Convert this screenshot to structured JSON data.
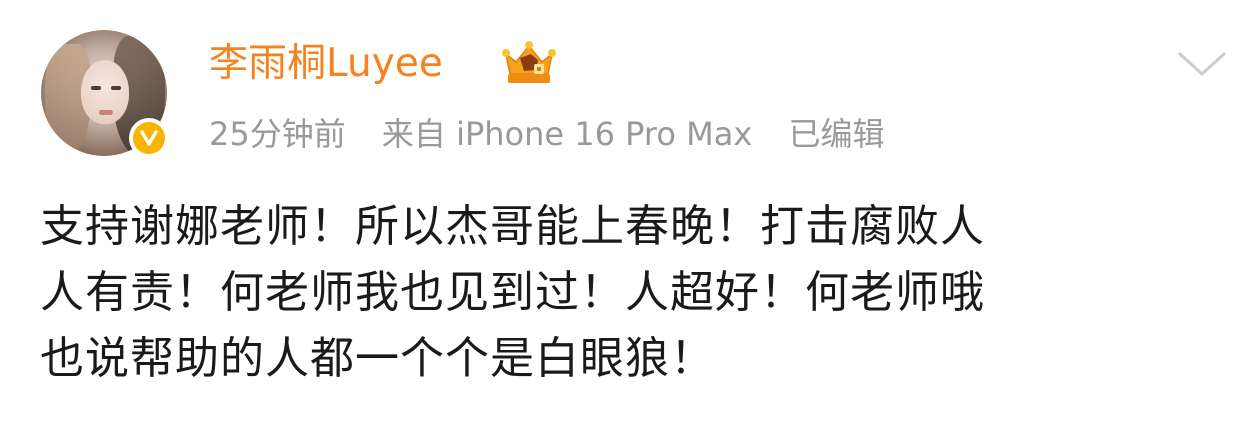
{
  "post": {
    "user": {
      "name": "李雨桐Luyee",
      "avatar_icon": "user-avatar",
      "verified_badge_icon": "verified-v-icon",
      "member_badge_icon": "crown-icon"
    },
    "meta": {
      "time": "25分钟前",
      "source": "来自 iPhone 16 Pro Max",
      "edited": "已编辑"
    },
    "content_lines": [
      "支持谢娜老师！所以杰哥能上春晚！打击腐败人",
      "人有责！何老师我也见到过！人超好！何老师哦",
      "也说帮助的人都一个个是白眼狼！"
    ],
    "more_menu_icon": "chevron-down-icon"
  },
  "colors": {
    "username": "#f7811f",
    "meta": "#999999",
    "text": "#1a1a1a",
    "verified": "#f7b500",
    "chevron": "#cccccc"
  }
}
